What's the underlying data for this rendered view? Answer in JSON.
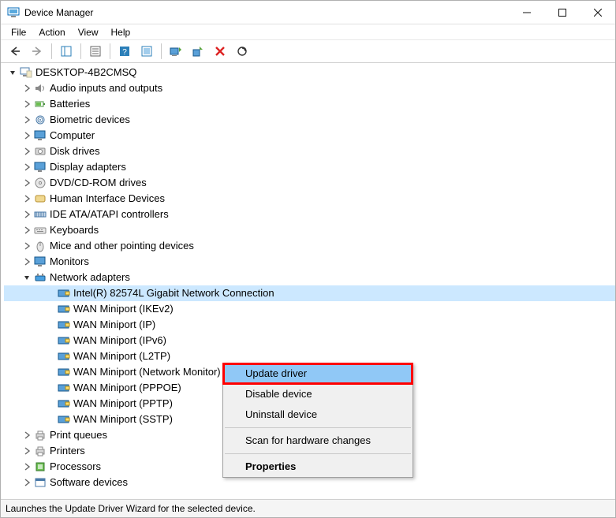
{
  "window": {
    "title": "Device Manager"
  },
  "menubar": [
    "File",
    "Action",
    "View",
    "Help"
  ],
  "statusbar": "Launches the Update Driver Wizard for the selected device.",
  "root": {
    "label": "DESKTOP-4B2CMSQ"
  },
  "categories": [
    {
      "label": "Audio inputs and outputs",
      "icon": "speaker"
    },
    {
      "label": "Batteries",
      "icon": "battery"
    },
    {
      "label": "Biometric devices",
      "icon": "fingerprint"
    },
    {
      "label": "Computer",
      "icon": "monitor"
    },
    {
      "label": "Disk drives",
      "icon": "disk"
    },
    {
      "label": "Display adapters",
      "icon": "monitor"
    },
    {
      "label": "DVD/CD-ROM drives",
      "icon": "disc"
    },
    {
      "label": "Human Interface Devices",
      "icon": "hid"
    },
    {
      "label": "IDE ATA/ATAPI controllers",
      "icon": "ide"
    },
    {
      "label": "Keyboards",
      "icon": "keyboard"
    },
    {
      "label": "Mice and other pointing devices",
      "icon": "mouse"
    },
    {
      "label": "Monitors",
      "icon": "monitor"
    },
    {
      "label": "Network adapters",
      "icon": "network",
      "expanded": true,
      "children": [
        {
          "label": "Intel(R) 82574L Gigabit Network Connection",
          "selected": true
        },
        {
          "label": "WAN Miniport (IKEv2)"
        },
        {
          "label": "WAN Miniport (IP)"
        },
        {
          "label": "WAN Miniport (IPv6)"
        },
        {
          "label": "WAN Miniport (L2TP)"
        },
        {
          "label": "WAN Miniport (Network Monitor)"
        },
        {
          "label": "WAN Miniport (PPPOE)"
        },
        {
          "label": "WAN Miniport (PPTP)"
        },
        {
          "label": "WAN Miniport (SSTP)"
        }
      ]
    },
    {
      "label": "Print queues",
      "icon": "printer"
    },
    {
      "label": "Printers",
      "icon": "printer"
    },
    {
      "label": "Processors",
      "icon": "cpu"
    },
    {
      "label": "Software devices",
      "icon": "software"
    }
  ],
  "context_menu": {
    "items": [
      {
        "label": "Update driver",
        "highlighted": true
      },
      {
        "label": "Disable device"
      },
      {
        "label": "Uninstall device"
      },
      {
        "sep": true
      },
      {
        "label": "Scan for hardware changes"
      },
      {
        "sep": true
      },
      {
        "label": "Properties",
        "bold": true
      }
    ]
  }
}
